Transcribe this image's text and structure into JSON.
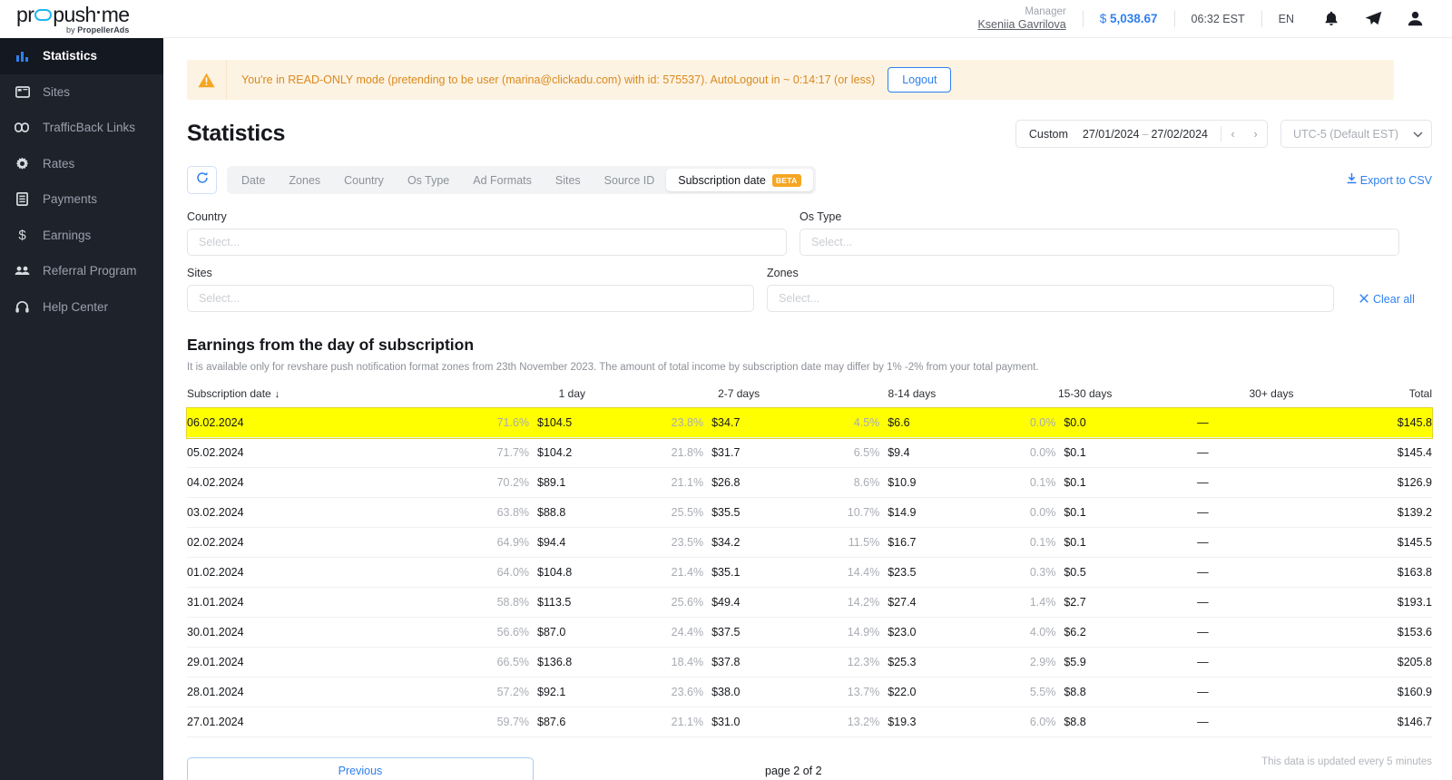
{
  "brand": {
    "logo_pre": "pr",
    "logo_post": "push",
    "logo_tail": "me",
    "tagline_pre": "by ",
    "tagline_bold": "PropellerAds"
  },
  "sidebar": {
    "items": [
      {
        "label": "Statistics",
        "icon": "bar-chart-icon",
        "active": true
      },
      {
        "label": "Sites",
        "icon": "browser-window-icon",
        "active": false
      },
      {
        "label": "TrafficBack Links",
        "icon": "link-icon",
        "active": false
      },
      {
        "label": "Rates",
        "icon": "gear-icon",
        "active": false
      },
      {
        "label": "Payments",
        "icon": "document-icon",
        "active": false
      },
      {
        "label": "Earnings",
        "icon": "dollar-icon",
        "active": false
      },
      {
        "label": "Referral Program",
        "icon": "people-icon",
        "active": false
      },
      {
        "label": "Help Center",
        "icon": "headset-icon",
        "active": false
      }
    ]
  },
  "topbar": {
    "manager_label": "Manager",
    "manager_name": "Kseniia Gavrilova",
    "currency_symbol": "$",
    "balance": "5,038.67",
    "clock": "06:32 EST",
    "language": "EN",
    "icons": [
      "bell-icon",
      "telegram-icon",
      "user-avatar-icon"
    ]
  },
  "banner": {
    "icon": "warning-triangle-icon",
    "text": "You're in READ-ONLY mode (pretending to be user (marina@clickadu.com) with id: 575537). AutoLogout in ~ 0:14:17 (or less)",
    "logout_label": "Logout"
  },
  "page": {
    "title": "Statistics"
  },
  "daterange": {
    "preset_label": "Custom",
    "start": "27/01/2024",
    "end": "27/02/2024",
    "dash": "–",
    "prev_icon": "chevron-left-icon",
    "next_icon": "chevron-right-icon"
  },
  "timezone": {
    "value": "UTC-5 (Default EST)",
    "chevron": "chevron-down-icon"
  },
  "toolbar": {
    "refresh_icon": "refresh-icon",
    "export_label": "Export to CSV",
    "export_icon": "download-icon",
    "tabs": [
      {
        "label": "Date",
        "active": false,
        "badge": ""
      },
      {
        "label": "Zones",
        "active": false,
        "badge": ""
      },
      {
        "label": "Country",
        "active": false,
        "badge": ""
      },
      {
        "label": "Os Type",
        "active": false,
        "badge": ""
      },
      {
        "label": "Ad Formats",
        "active": false,
        "badge": ""
      },
      {
        "label": "Sites",
        "active": false,
        "badge": ""
      },
      {
        "label": "Source ID",
        "active": false,
        "badge": ""
      },
      {
        "label": "Subscription date",
        "active": true,
        "badge": "BETA"
      }
    ]
  },
  "filters": {
    "country": {
      "label": "Country",
      "placeholder": "Select...",
      "value": ""
    },
    "os_type": {
      "label": "Os Type",
      "placeholder": "Select...",
      "value": ""
    },
    "sites": {
      "label": "Sites",
      "placeholder": "Select...",
      "value": ""
    },
    "zones": {
      "label": "Zones",
      "placeholder": "Select...",
      "value": ""
    },
    "clear_all_label": "Clear all",
    "clear_all_icon": "close-x-icon"
  },
  "section": {
    "title": "Earnings from the day of subscription",
    "description": "It is available only for revshare push notification format zones from 23th November 2023. The amount of total income by subscription date may differ by 1% -2% from your total payment."
  },
  "table": {
    "columns": [
      "Subscription date",
      "1 day",
      "2-7 days",
      "8-14 days",
      "15-30 days",
      "30+ days",
      "Total"
    ],
    "sort_column": "Subscription date",
    "sort_icon": "arrow-down-icon",
    "rows": [
      {
        "date": "06.02.2024",
        "d1_pct": "71.6%",
        "d1_amt": "$104.5",
        "d27_pct": "23.8%",
        "d27_amt": "$34.7",
        "d814_pct": "4.5%",
        "d814_amt": "$6.6",
        "d1530_pct": "0.0%",
        "d1530_amt": "$0.0",
        "d30_plus": "—",
        "total": "$145.8",
        "highlight": true
      },
      {
        "date": "05.02.2024",
        "d1_pct": "71.7%",
        "d1_amt": "$104.2",
        "d27_pct": "21.8%",
        "d27_amt": "$31.7",
        "d814_pct": "6.5%",
        "d814_amt": "$9.4",
        "d1530_pct": "0.0%",
        "d1530_amt": "$0.1",
        "d30_plus": "—",
        "total": "$145.4",
        "highlight": false
      },
      {
        "date": "04.02.2024",
        "d1_pct": "70.2%",
        "d1_amt": "$89.1",
        "d27_pct": "21.1%",
        "d27_amt": "$26.8",
        "d814_pct": "8.6%",
        "d814_amt": "$10.9",
        "d1530_pct": "0.1%",
        "d1530_amt": "$0.1",
        "d30_plus": "—",
        "total": "$126.9",
        "highlight": false
      },
      {
        "date": "03.02.2024",
        "d1_pct": "63.8%",
        "d1_amt": "$88.8",
        "d27_pct": "25.5%",
        "d27_amt": "$35.5",
        "d814_pct": "10.7%",
        "d814_amt": "$14.9",
        "d1530_pct": "0.0%",
        "d1530_amt": "$0.1",
        "d30_plus": "—",
        "total": "$139.2",
        "highlight": false
      },
      {
        "date": "02.02.2024",
        "d1_pct": "64.9%",
        "d1_amt": "$94.4",
        "d27_pct": "23.5%",
        "d27_amt": "$34.2",
        "d814_pct": "11.5%",
        "d814_amt": "$16.7",
        "d1530_pct": "0.1%",
        "d1530_amt": "$0.1",
        "d30_plus": "—",
        "total": "$145.5",
        "highlight": false
      },
      {
        "date": "01.02.2024",
        "d1_pct": "64.0%",
        "d1_amt": "$104.8",
        "d27_pct": "21.4%",
        "d27_amt": "$35.1",
        "d814_pct": "14.4%",
        "d814_amt": "$23.5",
        "d1530_pct": "0.3%",
        "d1530_amt": "$0.5",
        "d30_plus": "—",
        "total": "$163.8",
        "highlight": false
      },
      {
        "date": "31.01.2024",
        "d1_pct": "58.8%",
        "d1_amt": "$113.5",
        "d27_pct": "25.6%",
        "d27_amt": "$49.4",
        "d814_pct": "14.2%",
        "d814_amt": "$27.4",
        "d1530_pct": "1.4%",
        "d1530_amt": "$2.7",
        "d30_plus": "—",
        "total": "$193.1",
        "highlight": false
      },
      {
        "date": "30.01.2024",
        "d1_pct": "56.6%",
        "d1_amt": "$87.0",
        "d27_pct": "24.4%",
        "d27_amt": "$37.5",
        "d814_pct": "14.9%",
        "d814_amt": "$23.0",
        "d1530_pct": "4.0%",
        "d1530_amt": "$6.2",
        "d30_plus": "—",
        "total": "$153.6",
        "highlight": false
      },
      {
        "date": "29.01.2024",
        "d1_pct": "66.5%",
        "d1_amt": "$136.8",
        "d27_pct": "18.4%",
        "d27_amt": "$37.8",
        "d814_pct": "12.3%",
        "d814_amt": "$25.3",
        "d1530_pct": "2.9%",
        "d1530_amt": "$5.9",
        "d30_plus": "—",
        "total": "$205.8",
        "highlight": false
      },
      {
        "date": "28.01.2024",
        "d1_pct": "57.2%",
        "d1_amt": "$92.1",
        "d27_pct": "23.6%",
        "d27_amt": "$38.0",
        "d814_pct": "13.7%",
        "d814_amt": "$22.0",
        "d1530_pct": "5.5%",
        "d1530_amt": "$8.8",
        "d30_plus": "—",
        "total": "$160.9",
        "highlight": false
      },
      {
        "date": "27.01.2024",
        "d1_pct": "59.7%",
        "d1_amt": "$87.6",
        "d27_pct": "21.1%",
        "d27_amt": "$31.0",
        "d814_pct": "13.2%",
        "d814_amt": "$19.3",
        "d1530_pct": "6.0%",
        "d1530_amt": "$8.8",
        "d30_plus": "—",
        "total": "$146.7",
        "highlight": false
      }
    ]
  },
  "pagination": {
    "previous_label": "Previous",
    "page_info": "page 2 of 2"
  },
  "footer": {
    "note": "This data is updated every 5 minutes"
  },
  "colors": {
    "accent": "#2f80ed",
    "sidebar_bg": "#1e222b",
    "highlight": "#ffff00",
    "warning_bg": "#fdf3e3",
    "warning_text": "#d98a1f",
    "beta_badge": "#f6a623",
    "logo_cyan": "#1fb6f0"
  }
}
